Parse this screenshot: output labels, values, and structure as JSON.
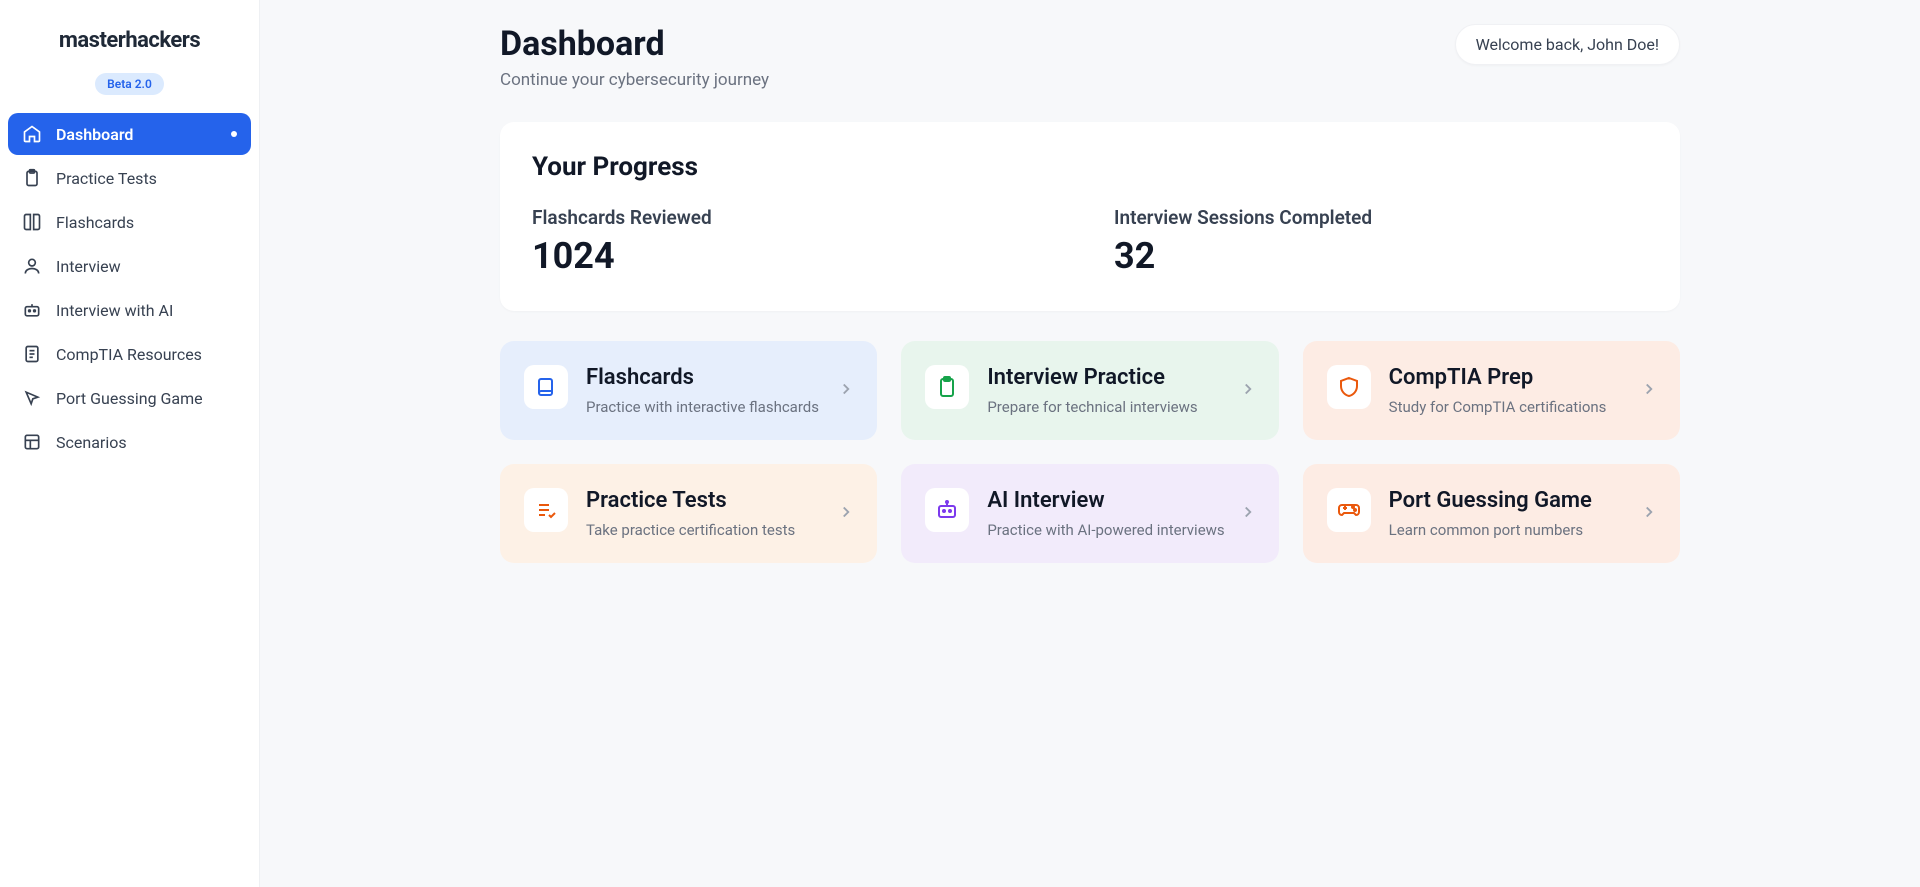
{
  "brand": "masterhackers",
  "beta_label": "Beta 2.0",
  "nav": {
    "dashboard": "Dashboard",
    "practice_tests": "Practice Tests",
    "flashcards": "Flashcards",
    "interview": "Interview",
    "interview_ai": "Interview with AI",
    "comptia": "CompTIA Resources",
    "port_game": "Port Guessing Game",
    "scenarios": "Scenarios"
  },
  "header": {
    "title": "Dashboard",
    "subtitle": "Continue your cybersecurity journey",
    "welcome": "Welcome back, John Doe!"
  },
  "progress": {
    "title": "Your Progress",
    "flashcards_label": "Flashcards Reviewed",
    "flashcards_value": "1024",
    "interviews_label": "Interview Sessions Completed",
    "interviews_value": "32"
  },
  "cards": {
    "flashcards": {
      "title": "Flashcards",
      "desc": "Practice with interactive flashcards"
    },
    "interview": {
      "title": "Interview Practice",
      "desc": "Prepare for technical interviews"
    },
    "comptia": {
      "title": "CompTIA Prep",
      "desc": "Study for CompTIA certifications"
    },
    "practice_tests": {
      "title": "Practice Tests",
      "desc": "Take practice certification tests"
    },
    "ai_interview": {
      "title": "AI Interview",
      "desc": "Practice with AI-powered interviews"
    },
    "port_game": {
      "title": "Port Guessing Game",
      "desc": "Learn common port numbers"
    }
  }
}
